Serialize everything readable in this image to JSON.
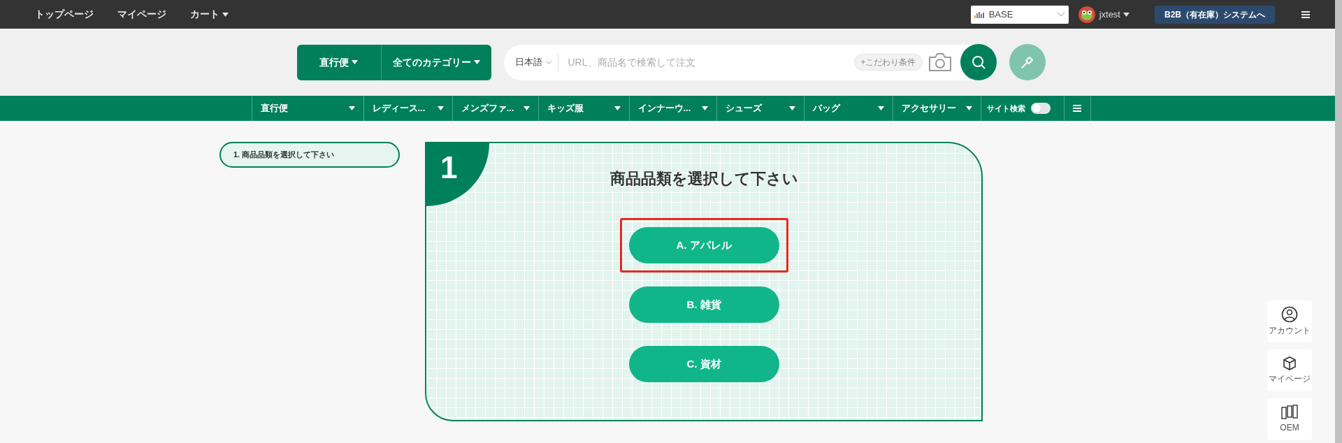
{
  "top_nav": {
    "links": [
      {
        "label": "トップページ",
        "has_caret": false
      },
      {
        "label": "マイページ",
        "has_caret": false
      },
      {
        "label": "カート",
        "has_caret": true
      }
    ],
    "store_select": {
      "value": "BASE"
    },
    "user": {
      "name": "jxtest"
    },
    "system_button": "B2B（有在庫）システムへ"
  },
  "search_bar": {
    "shipping_button": "直行便",
    "category_button": "全てのカテゴリー",
    "language": "日本語",
    "placeholder": "URL、商品名で検索して注文",
    "filter_chip": "+こだわり条件"
  },
  "category_nav": {
    "items": [
      {
        "label": "直行便"
      },
      {
        "label": "レディース..."
      },
      {
        "label": "メンズファ..."
      },
      {
        "label": "キッズ服"
      },
      {
        "label": "インナーウ..."
      },
      {
        "label": "シューズ"
      },
      {
        "label": "バッグ"
      },
      {
        "label": "アクセサリー"
      }
    ],
    "site_search": {
      "label": "サイト検索",
      "on": false
    }
  },
  "steps": [
    {
      "label": "1. 商品品類を選択して下さい",
      "selected": true
    }
  ],
  "card": {
    "step_number": "1",
    "title": "商品品類を選択して下さい",
    "options": [
      {
        "label": "A. アパレル",
        "highlighted": true
      },
      {
        "label": "B. 雑貨",
        "highlighted": false
      },
      {
        "label": "C. 資材",
        "highlighted": false
      }
    ]
  },
  "side_buttons": [
    {
      "kind": "account",
      "label": "アカウント"
    },
    {
      "kind": "mypage",
      "label": "マイページ"
    },
    {
      "kind": "oem",
      "label": "OEM"
    }
  ]
}
